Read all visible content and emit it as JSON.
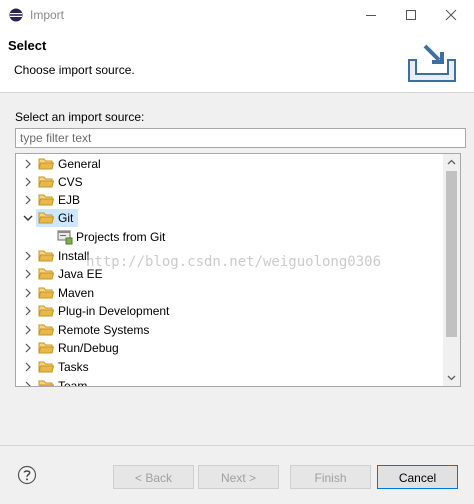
{
  "window": {
    "title": "Import"
  },
  "header": {
    "heading": "Select",
    "description": "Choose import source."
  },
  "source": {
    "label": "Select an import source:",
    "filter_placeholder": "type filter text"
  },
  "tree": {
    "items": [
      {
        "label": "General",
        "expanded": false
      },
      {
        "label": "CVS",
        "expanded": false
      },
      {
        "label": "EJB",
        "expanded": false
      },
      {
        "label": "Git",
        "expanded": true,
        "selected": true
      },
      {
        "label": "Projects from Git",
        "child": true
      },
      {
        "label": "Install",
        "expanded": false
      },
      {
        "label": "Java EE",
        "expanded": false
      },
      {
        "label": "Maven",
        "expanded": false
      },
      {
        "label": "Plug-in Development",
        "expanded": false
      },
      {
        "label": "Remote Systems",
        "expanded": false
      },
      {
        "label": "Run/Debug",
        "expanded": false
      },
      {
        "label": "Tasks",
        "expanded": false
      },
      {
        "label": "Team",
        "expanded": false
      }
    ]
  },
  "watermark": "http://blog.csdn.net/weiguolong0306",
  "buttons": {
    "back": "< Back",
    "next": "Next >",
    "finish": "Finish",
    "cancel": "Cancel"
  },
  "colors": {
    "selection": "#cce8ff",
    "folder": "#e8b84a",
    "accent": "#0078d7"
  }
}
